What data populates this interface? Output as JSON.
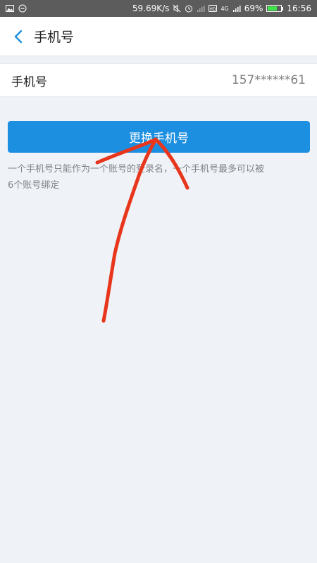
{
  "status_bar": {
    "network_speed": "59.69K/s",
    "battery_percent": "69%",
    "battery_level": 0.69,
    "network_type": "4G",
    "time": "16:56",
    "icons": [
      "image-icon",
      "minus-circle-icon",
      "mute-icon",
      "alarm-icon",
      "signal-icon",
      "hd-icon",
      "battery-icon"
    ]
  },
  "header": {
    "back_icon": "chevron-left-icon",
    "title": "手机号"
  },
  "phone_row": {
    "label": "手机号",
    "value": "157******61"
  },
  "actions": {
    "change_label": "更换手机号"
  },
  "note": {
    "line1": "一个手机号只能作为一个账号的登录名，一个手机号最多可以被",
    "line2": "6个账号绑定"
  },
  "colors": {
    "accent": "#1d8fe1",
    "background": "#eff2f6",
    "annotation": "#e8361c"
  }
}
